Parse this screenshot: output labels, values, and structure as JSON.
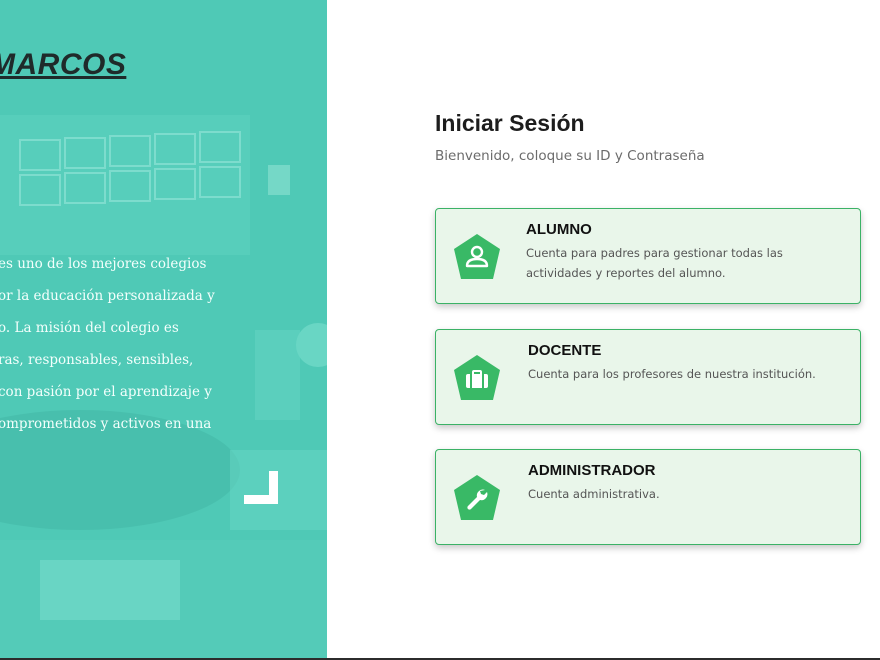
{
  "hero": {
    "title": "MARCOS",
    "paragraph_lines": [
      "es uno de los mejores colegios",
      "or la educación personalizada y",
      "o. La misión del colegio es",
      "ras, responsables, sensibles,",
      "con pasión por el aprendizaje y",
      "omprometidos y activos en una"
    ]
  },
  "login": {
    "title": "Iniciar Sesión",
    "subtitle": "Bienvenido, coloque su ID y Contraseña"
  },
  "accounts": [
    {
      "title": "ALUMNO",
      "description": "Cuenta para padres para gestionar todas las actividades y reportes del alumno.",
      "icon": "user-icon"
    },
    {
      "title": "DOCENTE",
      "description": "Cuenta para los profesores de nuestra institución.",
      "icon": "briefcase-icon"
    },
    {
      "title": "ADMINISTRADOR",
      "description": "Cuenta administrativa.",
      "icon": "wrench-icon"
    }
  ],
  "colors": {
    "hero_teal": "#4fc9b6",
    "accent_green": "#3bb266",
    "card_bg": "#e9f6ea"
  }
}
